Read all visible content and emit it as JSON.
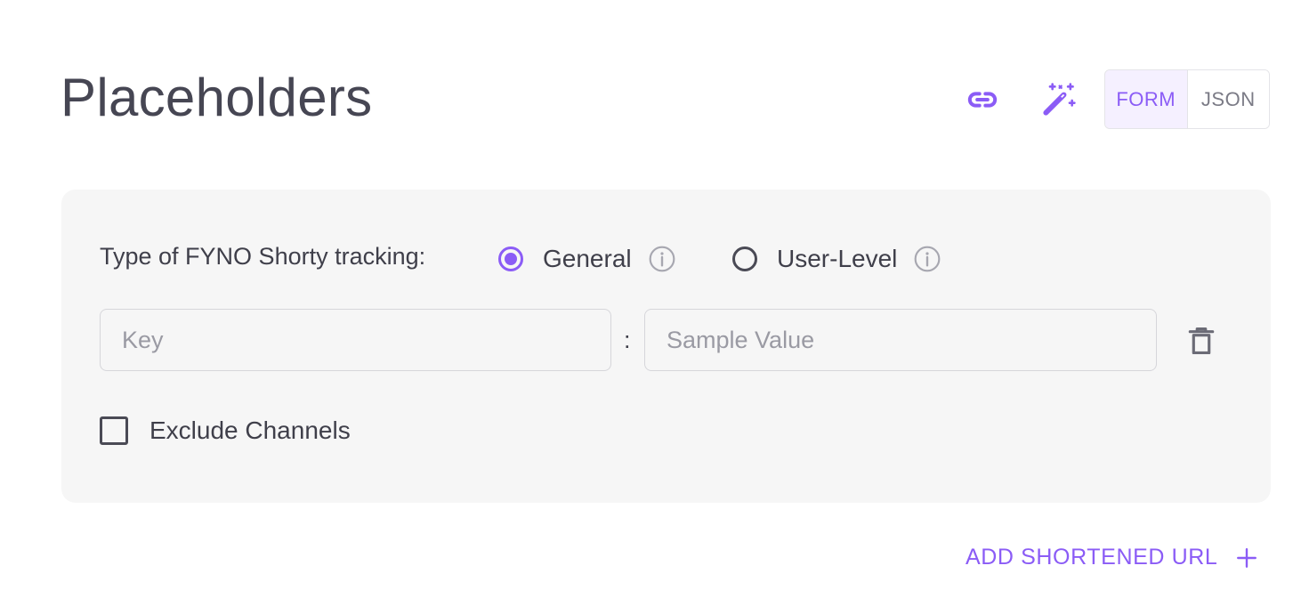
{
  "header": {
    "title": "Placeholders",
    "link_icon": "link-icon",
    "magic_icon": "magic-wand-icon",
    "toggle": {
      "form_label": "FORM",
      "json_label": "JSON",
      "selected": "FORM"
    }
  },
  "card": {
    "tracking_label": "Type of FYNO Shorty tracking:",
    "options": [
      {
        "label": "General",
        "selected": true,
        "info_icon": "info-icon"
      },
      {
        "label": "User-Level",
        "selected": false,
        "info_icon": "info-icon"
      }
    ],
    "key_placeholder": "Key",
    "key_value": "",
    "separator": ":",
    "value_placeholder": "Sample Value",
    "value_value": "",
    "delete_icon": "trash-icon",
    "exclude_label": "Exclude Channels",
    "exclude_checked": false
  },
  "footer": {
    "add_url_label": "ADD SHORTENED URL",
    "add_icon": "plus-icon"
  },
  "colors": {
    "accent": "#8b5cf6",
    "text": "#3f3f4a",
    "card_bg": "#f6f6f6",
    "toggle_selected_bg": "#f5f0ff"
  }
}
